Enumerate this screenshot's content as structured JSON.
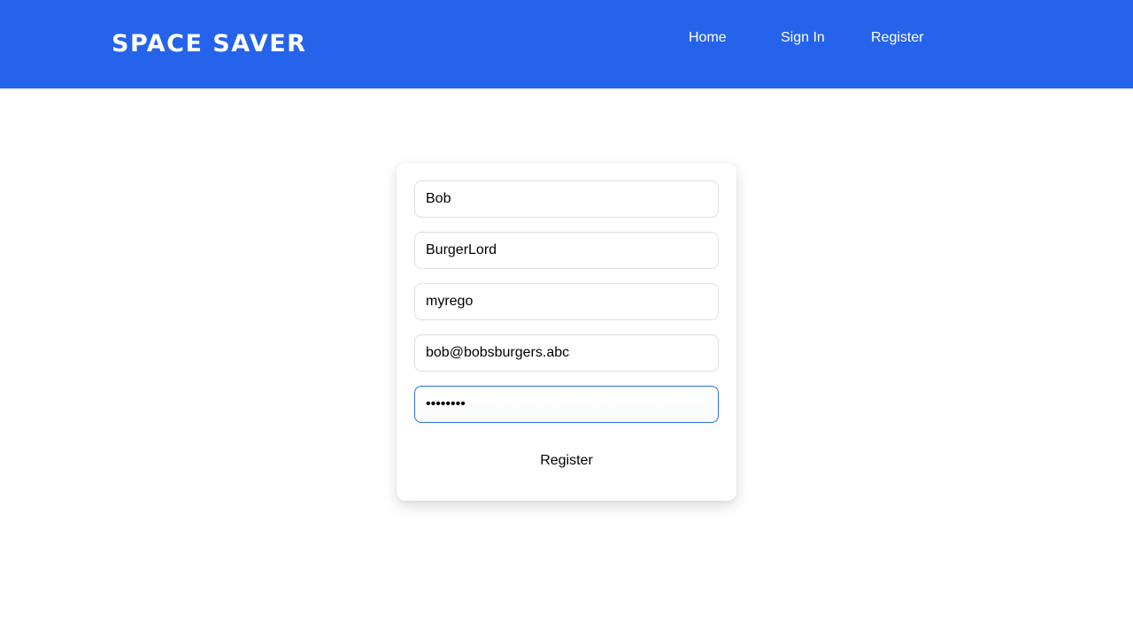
{
  "header": {
    "brand": "SPACE SAVER",
    "background_color": "#2563eb",
    "nav": {
      "home": "Home",
      "sign_in": "Sign In",
      "register": "Register"
    }
  },
  "form": {
    "first_name": {
      "value": "Bob"
    },
    "last_name": {
      "value": "BurgerLord"
    },
    "rego": {
      "value": "myrego"
    },
    "email": {
      "value": "bob@bobsburgers.abc"
    },
    "password": {
      "value": "bobsburg",
      "focused": true
    },
    "submit_label": "Register",
    "focus_color": "#2b6fe0"
  }
}
